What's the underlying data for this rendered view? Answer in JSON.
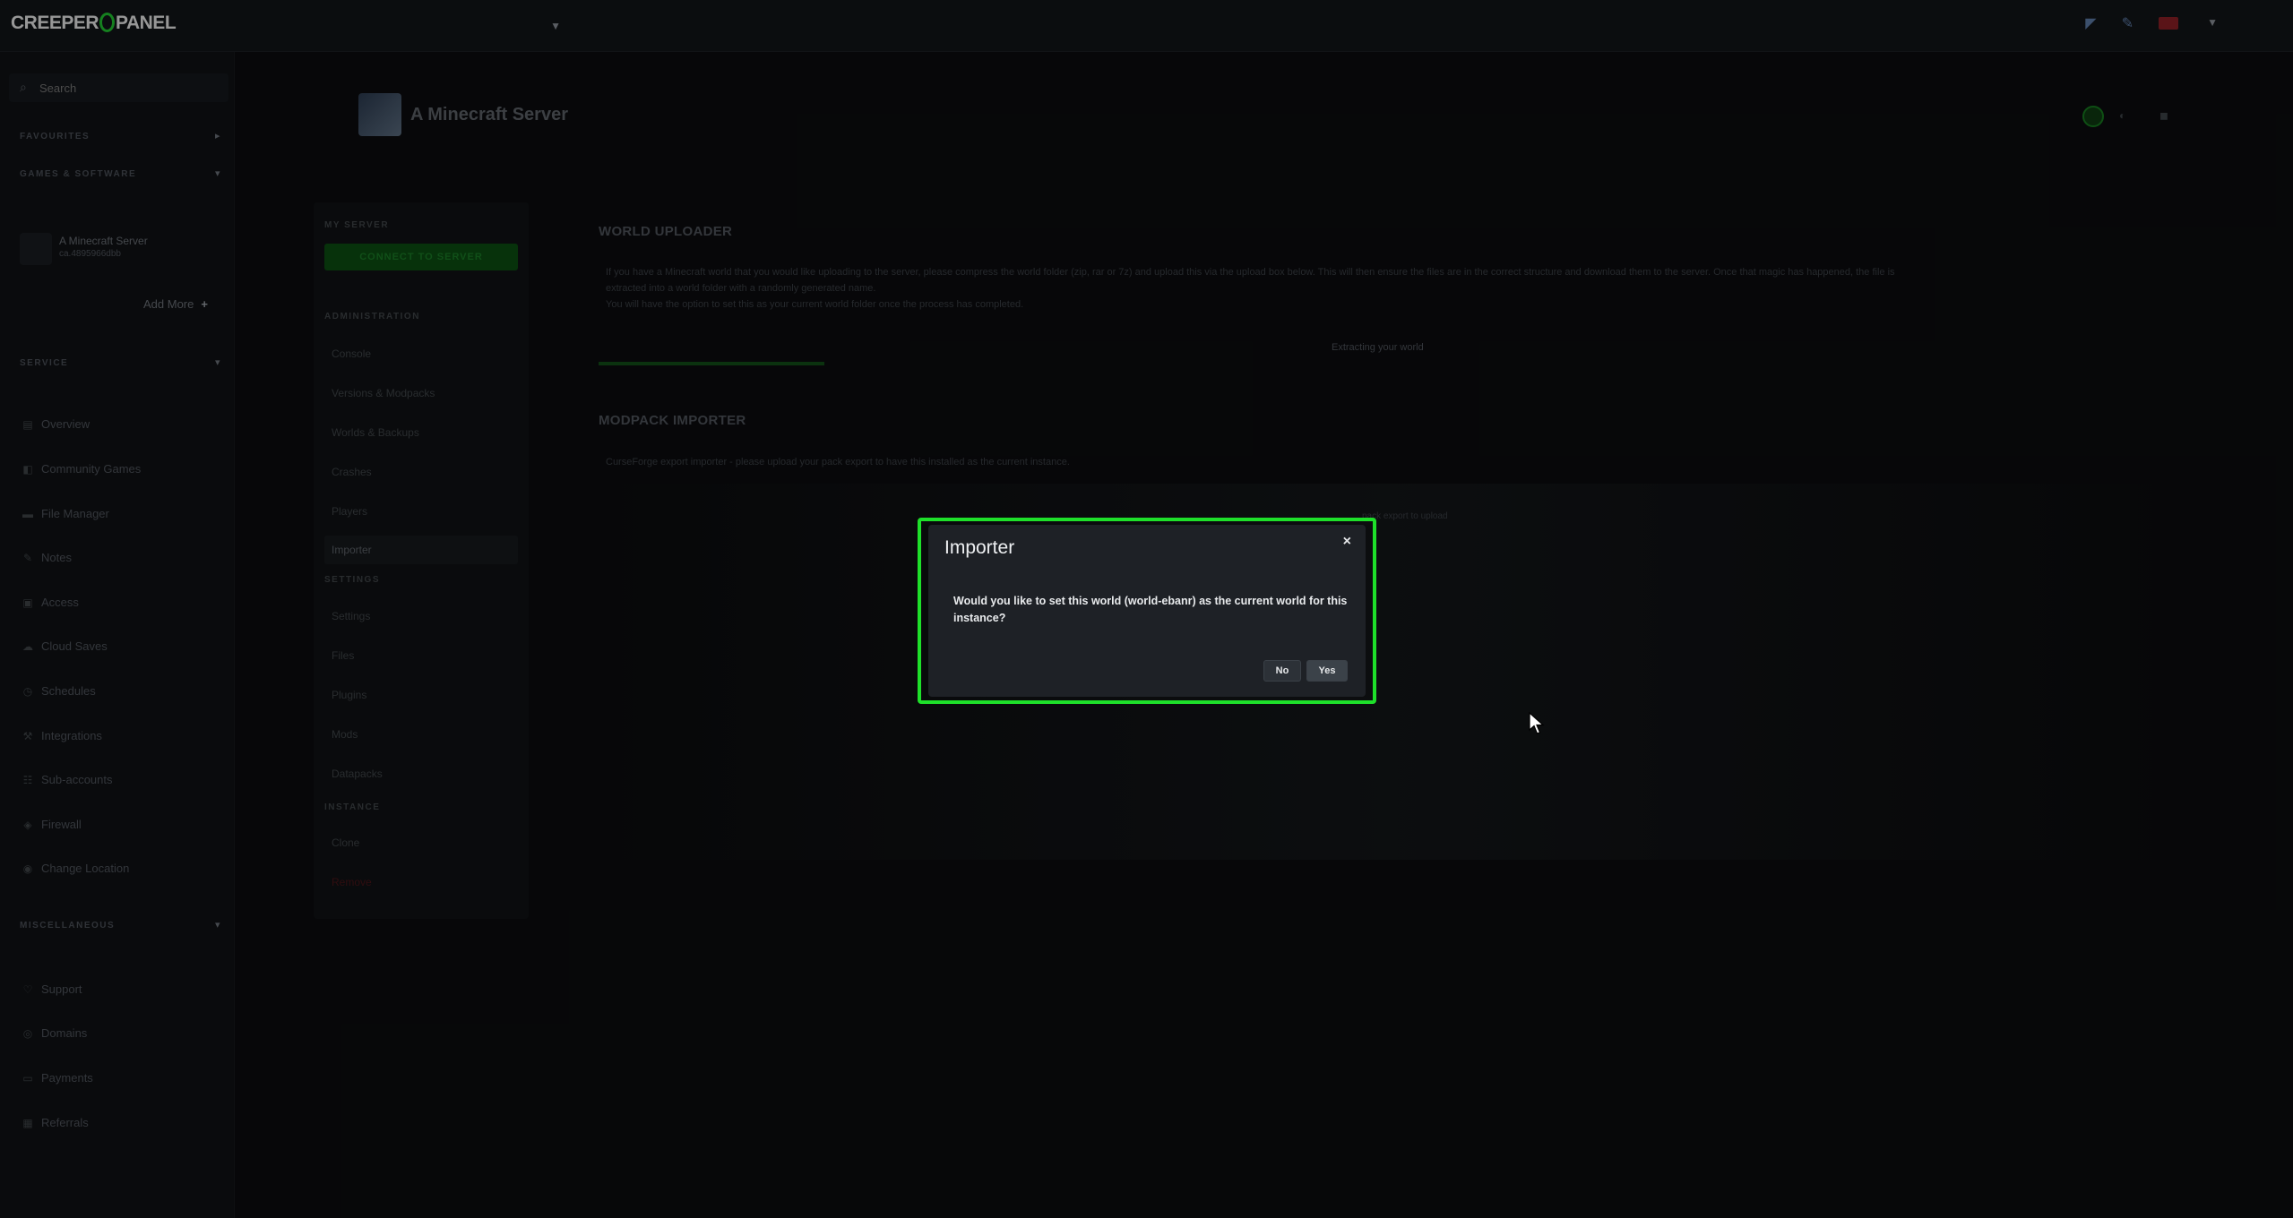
{
  "brand": {
    "logo_left": "CREEPER",
    "logo_right": "PANEL",
    "accent": "#21c530"
  },
  "sidebar": {
    "search_placeholder": "Search",
    "sections": {
      "favourites": "FAVOURITES",
      "games": "GAMES & SOFTWARE",
      "service": "SERVICE",
      "misc": "MISCELLANEOUS"
    },
    "server_card": {
      "name": "A Minecraft Server",
      "ip": "ca.4895966dbb"
    },
    "add_more": "Add More",
    "nav": [
      "Overview",
      "Community Games",
      "File Manager",
      "Notes",
      "Access",
      "Cloud Saves",
      "Schedules",
      "Integrations",
      "Sub-accounts",
      "Firewall",
      "Change Location"
    ],
    "misc_nav": [
      "Support",
      "Domains",
      "Payments",
      "Referrals"
    ]
  },
  "header": {
    "title": "A Minecraft Server"
  },
  "subnav": {
    "my_server": "MY SERVER",
    "connect_label": "CONNECT TO SERVER",
    "administration": "ADMINISTRATION",
    "admin_items": [
      "Console",
      "Versions & Modpacks",
      "Worlds & Backups",
      "Crashes",
      "Players",
      "Importer"
    ],
    "settings": "SETTINGS",
    "settings_items": [
      "Settings",
      "Files",
      "Plugins",
      "Mods",
      "Datapacks"
    ],
    "instance": "INSTANCE",
    "instance_items": [
      "Clone",
      "Remove"
    ]
  },
  "main": {
    "world_uploader": {
      "heading": "WORLD UPLOADER",
      "text_line1": "If you have a Minecraft world that you would like uploading to the server, please compress the world folder (zip, rar or 7z) and upload this via the upload box below. This will then ensure the files are in the correct structure and download them to the server. Once that magic has happened, the file is",
      "text_line2": "extracted into a world folder with a randomly generated name.",
      "text_line3": "You will have the option to set this as your current world folder once the process has completed.",
      "progress_percent": 14.3,
      "progress_text": "Extracting your world"
    },
    "modpack_importer": {
      "heading": "MODPACK IMPORTER",
      "text": "CurseForge export importer - please upload your pack export to have this installed as the current instance.",
      "drop_hint": "pack export to upload"
    }
  },
  "modal": {
    "title": "Importer",
    "close": "×",
    "body": "Would you like to set this world (world-ebanr) as the current world for this instance?",
    "no_label": "No",
    "yes_label": "Yes",
    "highlight_color": "#1ee02a"
  }
}
